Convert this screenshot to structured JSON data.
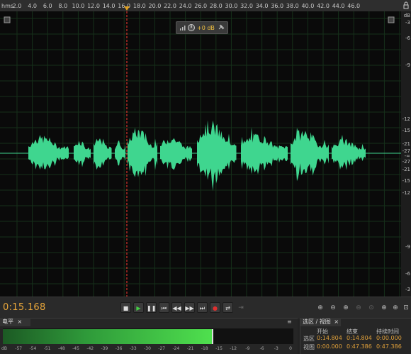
{
  "ruler": {
    "unit": "hms",
    "ticks": [
      "2.0",
      "4.0",
      "6.0",
      "8.0",
      "10.0",
      "12.0",
      "14.0",
      "16.0",
      "18.0",
      "20.0",
      "22.0",
      "24.0",
      "26.0",
      "28.0",
      "30.0",
      "32.0",
      "34.0",
      "36.0",
      "38.0",
      "40.0",
      "42.0",
      "44.0",
      "46.0"
    ]
  },
  "db_labels": [
    "dB",
    "-3",
    "-6",
    "-9",
    "-12",
    "-15",
    "-21",
    "-27",
    "-∞",
    "-27",
    "-21",
    "-15",
    "-12",
    "-9",
    "-6",
    "-3"
  ],
  "db_labels_lower": [
    "-3",
    "-6",
    "-9",
    "-12",
    "-15",
    "-21",
    "-27",
    "-∞",
    "-27",
    "-21",
    "-15",
    "-12",
    "-9",
    "-6",
    "-3"
  ],
  "hud": {
    "gain": "+0 dB"
  },
  "transport": {
    "time": "0:15.168",
    "buttons": [
      "stop",
      "play",
      "pause",
      "go-to-start",
      "rewind",
      "fast-forward",
      "go-to-end",
      "record",
      "loop",
      "skip"
    ]
  },
  "level_panel": {
    "tab_label": "电平",
    "scale": [
      "dB",
      "-57",
      "-54",
      "-51",
      "-48",
      "-45",
      "-42",
      "-39",
      "-36",
      "-33",
      "-30",
      "-27",
      "-24",
      "-21",
      "-18",
      "-15",
      "-12",
      "-9",
      "-6",
      "-3",
      "0"
    ],
    "level_fraction": 0.72
  },
  "selection_panel": {
    "tab_label": "选区 / 视图",
    "headers": {
      "start": "开始",
      "end": "结束",
      "duration": "持续时间"
    },
    "rows": [
      {
        "label": "选区",
        "start": "0:14.804",
        "end": "0:14.804",
        "duration": "0:00.000"
      },
      {
        "label": "视图",
        "start": "0:00.000",
        "end": "0:47.386",
        "duration": "0:47.386"
      }
    ]
  },
  "colors": {
    "waveform": "#3fd68f",
    "playhead": "#ff3b30",
    "time": "#e8a63a",
    "grid": "#1f3a1f"
  }
}
